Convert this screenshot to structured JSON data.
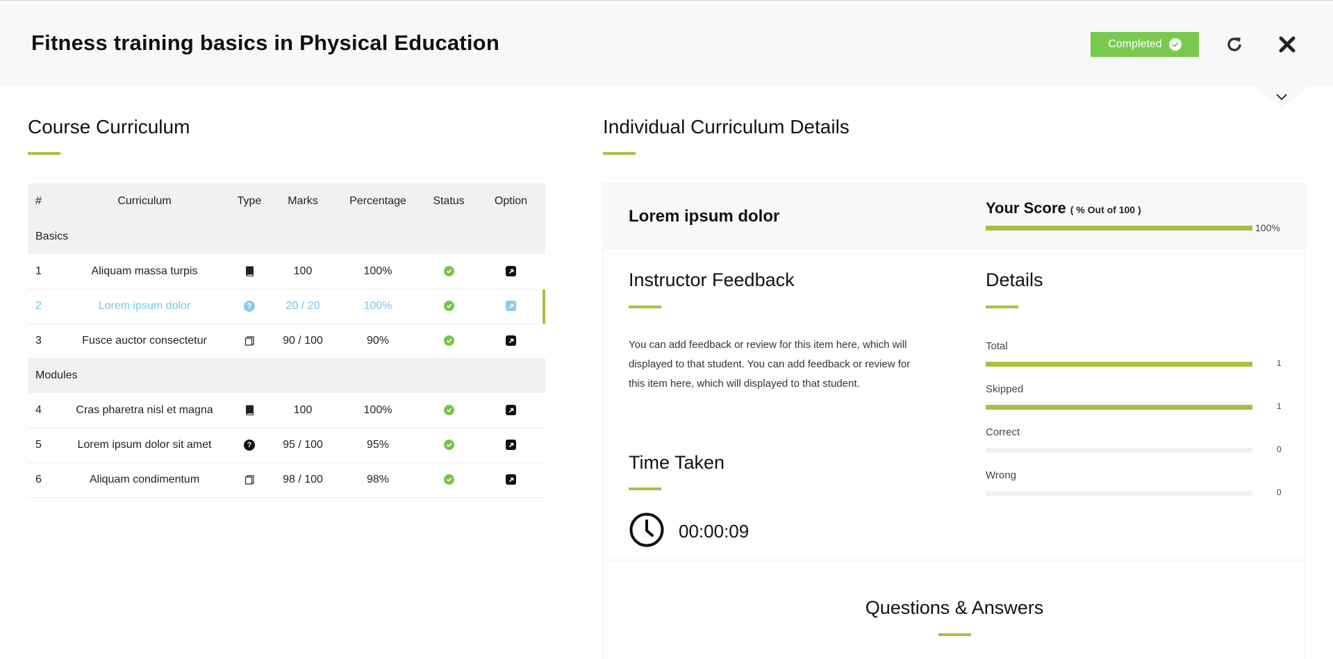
{
  "header": {
    "title": "Fitness training basics in Physical Education",
    "status_label": "Completed",
    "refresh_icon": "refresh-icon",
    "close_icon": "close-icon"
  },
  "curriculum": {
    "title": "Course Curriculum",
    "columns": [
      "#",
      "Curriculum",
      "Type",
      "Marks",
      "Percentage",
      "Status",
      "Option"
    ],
    "groups": [
      {
        "name": "Basics",
        "rows": [
          {
            "num": "1",
            "name": "Aliquam massa turpis",
            "type": "book-icon",
            "marks": "100",
            "percentage": "100%",
            "status": "complete",
            "active": false
          },
          {
            "num": "2",
            "name": "Lorem ipsum dolor",
            "type": "question-icon",
            "marks": "20 / 20",
            "percentage": "100%",
            "status": "complete",
            "active": true
          },
          {
            "num": "3",
            "name": "Fusce auctor consectetur",
            "type": "pages-icon",
            "marks": "90 / 100",
            "percentage": "90%",
            "status": "complete",
            "active": false
          }
        ]
      },
      {
        "name": "Modules",
        "rows": [
          {
            "num": "4",
            "name": "Cras pharetra nisl et magna",
            "type": "book-icon",
            "marks": "100",
            "percentage": "100%",
            "status": "complete",
            "active": false
          },
          {
            "num": "5",
            "name": "Lorem ipsum dolor sit amet",
            "type": "question-icon",
            "marks": "95 / 100",
            "percentage": "95%",
            "status": "complete",
            "active": false
          },
          {
            "num": "6",
            "name": "Aliquam condimentum",
            "type": "pages-icon",
            "marks": "98 / 100",
            "percentage": "98%",
            "status": "complete",
            "active": false
          }
        ]
      }
    ]
  },
  "details_panel": {
    "title": "Individual Curriculum Details",
    "item_name": "Lorem ipsum dolor",
    "score_label": "Your Score",
    "score_sub": "( % Out of 100 )",
    "score_value": 100,
    "score_text": "100%",
    "feedback_title": "Instructor Feedback",
    "feedback_text": "You can add feedback or review for this item here, which will displayed to that student. You can add feedback or review for this item here, which will displayed to that student.",
    "time_title": "Time Taken",
    "time_value": "00:00:09",
    "details_title": "Details",
    "details": [
      {
        "label": "Total",
        "value": "1",
        "fraction": 1
      },
      {
        "label": "Skipped",
        "value": "1",
        "fraction": 1
      },
      {
        "label": "Correct",
        "value": "0",
        "fraction": 0
      },
      {
        "label": "Wrong",
        "value": "0",
        "fraction": 0
      }
    ],
    "qa_title": "Questions & Answers"
  },
  "colors": {
    "accent": "#a8bf3f",
    "completed": "#7ac94f",
    "active_row": "#79c6e8"
  }
}
